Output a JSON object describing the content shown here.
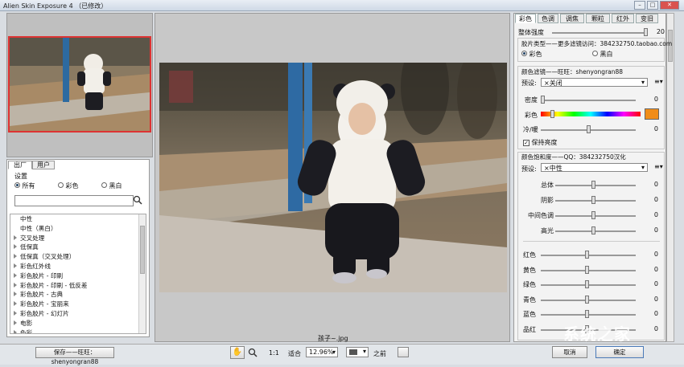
{
  "window": {
    "title": "Alien Skin Exposure 4 （已修改）",
    "min": "–",
    "max": "□",
    "close": "✕"
  },
  "left": {
    "tabs": [
      "出厂",
      "用户"
    ],
    "settings_label": "设置",
    "filters": [
      "所有",
      "彩色",
      "黑白"
    ],
    "search_placeholder": "",
    "items": [
      {
        "label": "中性",
        "expandable": false
      },
      {
        "label": "中性（黑白）",
        "expandable": false
      },
      {
        "label": "交叉处理",
        "expandable": true
      },
      {
        "label": "低保真",
        "expandable": true
      },
      {
        "label": "低保真（交叉处理）",
        "expandable": true
      },
      {
        "label": "彩色红外线",
        "expandable": true
      },
      {
        "label": "彩色胶片 - 印刷",
        "expandable": true
      },
      {
        "label": "彩色胶片 - 印刷 - 低反差",
        "expandable": true
      },
      {
        "label": "彩色胶片 - 古典",
        "expandable": true
      },
      {
        "label": "彩色胶片 - 宝丽来",
        "expandable": true
      },
      {
        "label": "彩色胶片 - 幻灯片",
        "expandable": true
      },
      {
        "label": "电影",
        "expandable": true
      },
      {
        "label": "色彩",
        "expandable": true
      }
    ]
  },
  "center": {
    "filename": "孩子~.jpg"
  },
  "right": {
    "tabs": [
      "彩色",
      "色调",
      "调焦",
      "颗粒",
      "红外",
      "变旧"
    ],
    "overall_intensity": {
      "label": "整体强度",
      "value": "20",
      "level": 1.0
    },
    "film_type": {
      "title": "胶片类型——更多滤镜访问：384232750.taobao.com",
      "options": [
        "彩色",
        "黑白"
      ]
    },
    "color_filter": {
      "title": "颜色滤镜——旺旺：shenyongran88",
      "preset_label": "预设:",
      "preset_value": "×关闭",
      "density_label": "密度",
      "density_value": "0",
      "color_label": "彩色",
      "cool_warm_label": "冷/暖",
      "cool_warm_value": "0",
      "keep_luminance": "保持亮度",
      "swatch_color": "#f08c18"
    },
    "saturation": {
      "title": "颜色饱和度——QQ：384232750汉化",
      "preset_label": "预设:",
      "preset_value": "×中性",
      "rows": [
        {
          "label": "总体",
          "value": "0"
        },
        {
          "label": "阴影",
          "value": "0"
        },
        {
          "label": "中间色调",
          "value": "0"
        },
        {
          "label": "高光",
          "value": "0"
        }
      ],
      "channels": [
        {
          "label": "红色",
          "value": "0"
        },
        {
          "label": "黄色",
          "value": "0"
        },
        {
          "label": "绿色",
          "value": "0"
        },
        {
          "label": "青色",
          "value": "0"
        },
        {
          "label": "蓝色",
          "value": "0"
        },
        {
          "label": "品红",
          "value": "0"
        }
      ]
    }
  },
  "bottom": {
    "save_button": "保存——旺旺：shenyongran88",
    "zoom_1to1": "1:1",
    "fit_label": "适合",
    "zoom_value": "12.96%",
    "before_label": "之前",
    "ok_button": "确定",
    "cancel_button": "取消"
  },
  "watermark": "系统之家",
  "colors": {
    "accent_red": "#d33333",
    "swatch": "#f08c18"
  }
}
